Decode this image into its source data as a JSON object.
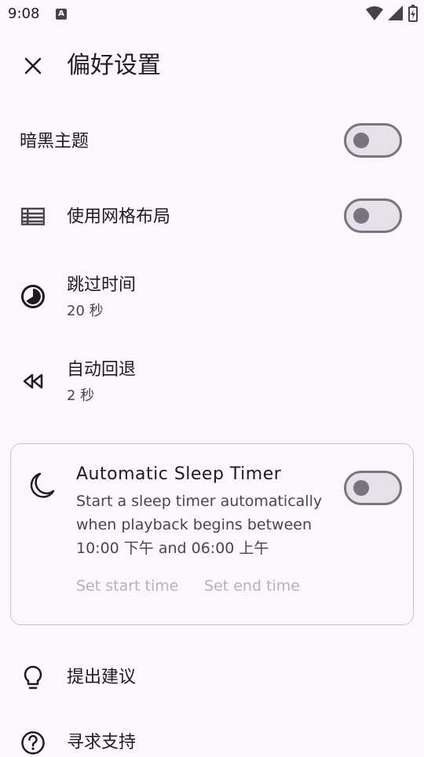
{
  "status": {
    "time": "9:08",
    "notif_badge": "A"
  },
  "header": {
    "title": "偏好设置"
  },
  "settings": {
    "dark_theme": {
      "label": "暗黑主题",
      "enabled": false
    },
    "grid_layout": {
      "label": "使用网格布局",
      "enabled": false
    },
    "skip_time": {
      "label": "跳过时间",
      "value": "20 秒"
    },
    "auto_rewind": {
      "label": "自动回退",
      "value": "2 秒"
    }
  },
  "sleep_timer": {
    "title": "Automatic Sleep Timer",
    "description": "Start a sleep timer automatically when playback begins between 10:00 下午 and 06:00 上午",
    "enabled": false,
    "start_label": "Set start time",
    "end_label": "Set end time"
  },
  "links": {
    "suggest": "提出建议",
    "support": "寻求支持"
  },
  "colors": {
    "background": "#fdf7fd",
    "switch_track": "#e6e0e9",
    "switch_outline": "#79747e"
  }
}
